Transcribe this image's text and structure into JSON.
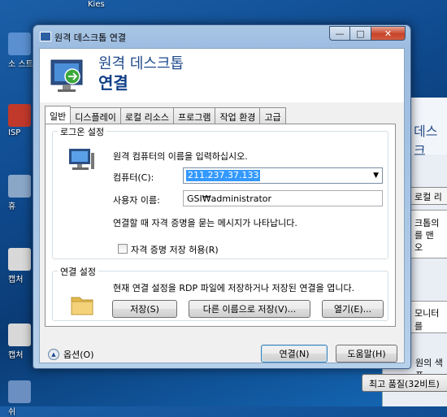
{
  "desktop": {
    "kies_label": "Kies",
    "icons": [
      {
        "label": "소 스트",
        "color": "#5a8fd0"
      },
      {
        "label": "ISP",
        "color": "#c0392b"
      },
      {
        "label": "휴",
        "color": "#8aa7c8"
      },
      {
        "label": "캡처",
        "color": "#d8d8d8"
      },
      {
        "label": "캡처",
        "color": "#d8d8d8"
      },
      {
        "label": "쉬",
        "color": "#6a8fc0"
      }
    ]
  },
  "background_window": {
    "header_text": "데스크",
    "tab_text": "로컬 리",
    "pane_text": "크톱의 를 맨 오",
    "pane2_text": "모니터를",
    "color_text": "원의 색 품",
    "quality_button": "최고 품질(32비트)"
  },
  "dialog": {
    "title": "원격 데스크톱 연결",
    "header_line1": "원격 데스크톱",
    "header_line2": "연결",
    "window_buttons": {
      "minimize": "—",
      "maximize": "□",
      "close": "✕"
    },
    "tabs": [
      "일반",
      "디스플레이",
      "로컬 리소스",
      "프로그램",
      "작업 환경",
      "고급"
    ],
    "active_tab": "일반",
    "logon": {
      "group_title": "로그온 설정",
      "instruction": "원격 컴퓨터의 이름을 입력하십시오.",
      "computer_label": "컴퓨터(C):",
      "computer_value": "211.237.37.133",
      "user_label": "사용자 이름:",
      "user_value": "GSI₩administrator",
      "credential_note": "연결할 때 자격 증명을 묻는 메시지가 나타납니다.",
      "save_credentials": "자격 증명 저장 허용(R)",
      "save_credentials_checked": false
    },
    "connection": {
      "group_title": "연결 설정",
      "description": "현재 연결 설정을 RDP 파일에 저장하거나 저장된 연결을 엽니다.",
      "save_button": "저장(S)",
      "save_as_button": "다른 이름으로 저장(V)...",
      "open_button": "열기(E)..."
    },
    "options_label": "옵션(O)",
    "connect_button": "연결(N)",
    "help_button": "도움말(H)"
  },
  "colors": {
    "title_blue": "#1e4a8c",
    "selection": "#3399ff"
  }
}
